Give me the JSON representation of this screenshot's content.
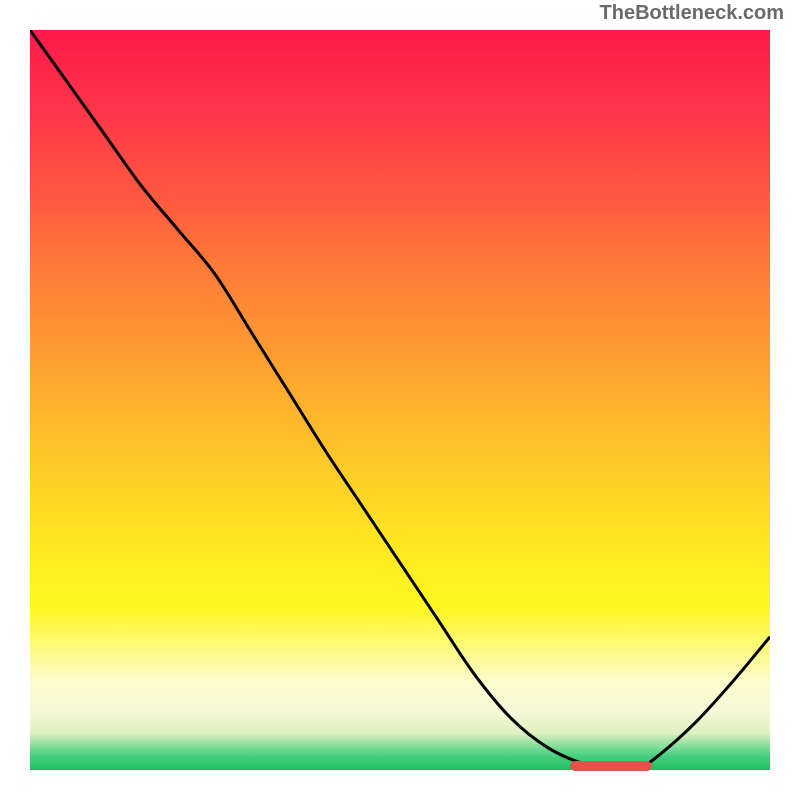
{
  "watermark": "TheBottleneck.com",
  "chart_data": {
    "type": "line",
    "title": "",
    "xlabel": "",
    "ylabel": "",
    "xlim": [
      0,
      100
    ],
    "ylim": [
      0,
      100
    ],
    "grid": false,
    "series": [
      {
        "name": "curve",
        "color": "#000000",
        "x": [
          0,
          5,
          10,
          15,
          20,
          25,
          30,
          35,
          40,
          45,
          50,
          55,
          60,
          65,
          70,
          75,
          80,
          82,
          85,
          90,
          95,
          100
        ],
        "values": [
          100,
          93,
          86,
          79,
          73,
          67,
          59,
          51,
          43,
          35.5,
          28,
          20.5,
          13,
          7,
          3,
          0.8,
          0,
          0,
          2,
          6.5,
          12,
          18
        ]
      }
    ],
    "annotations": {
      "marker": {
        "x_start": 73,
        "x_end": 84,
        "y": 0.5,
        "color": "#e0544c"
      }
    },
    "gradient_stops": [
      {
        "pos": 0,
        "color": "#ff1a4a"
      },
      {
        "pos": 10,
        "color": "#ff324a"
      },
      {
        "pos": 22,
        "color": "#ff5640"
      },
      {
        "pos": 32,
        "color": "#ff7a38"
      },
      {
        "pos": 45,
        "color": "#ffa030"
      },
      {
        "pos": 58,
        "color": "#ffc828"
      },
      {
        "pos": 70,
        "color": "#ffe820"
      },
      {
        "pos": 78,
        "color": "#fff820"
      },
      {
        "pos": 88,
        "color": "#fcfccc"
      },
      {
        "pos": 92,
        "color": "#f6f8d8"
      },
      {
        "pos": 95,
        "color": "#def0c0"
      },
      {
        "pos": 98,
        "color": "#48d080"
      },
      {
        "pos": 100,
        "color": "#20c060"
      }
    ]
  }
}
